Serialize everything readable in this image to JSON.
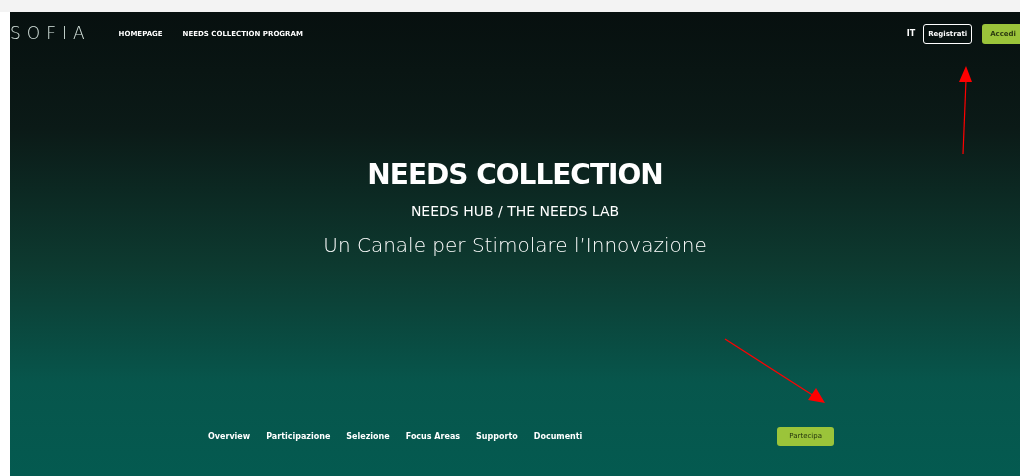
{
  "header": {
    "logo": "SOFIA",
    "nav": [
      {
        "label": "HOMEPAGE"
      },
      {
        "label": "NEEDS COLLECTION PROGRAM"
      }
    ],
    "language": "IT",
    "register_button": "Registrati",
    "login_button": "Accedi"
  },
  "hero": {
    "title": "NEEDS COLLECTION",
    "subtitle": "NEEDS HUB / THE NEEDS LAB",
    "tagline": "Un Canale per Stimolare l’Innovazione"
  },
  "section_nav": {
    "items": [
      {
        "label": "Overview"
      },
      {
        "label": "Participazione"
      },
      {
        "label": "Selezione"
      },
      {
        "label": "Focus Areas"
      },
      {
        "label": "Supporto"
      },
      {
        "label": "Documenti"
      }
    ],
    "cta_button": "Partecipa"
  }
}
